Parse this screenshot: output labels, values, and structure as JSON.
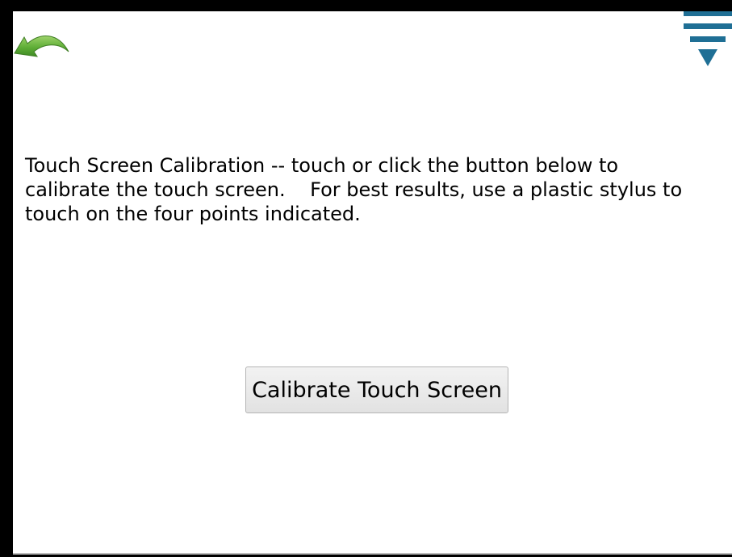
{
  "header": {
    "back_icon": "curved-back-arrow-icon",
    "menu_icon": "triangle-menu-icon"
  },
  "main": {
    "instructions": "Touch Screen Calibration -- touch or click the button below to\ncalibrate the touch screen.    For best results, use a plastic stylus to\ntouch on the four points indicated.",
    "calibrate_button_label": "Calibrate Touch Screen"
  },
  "colors": {
    "back_arrow": "#6cb33f",
    "menu_icon": "#1f6f95",
    "button_background": "#e9e9e9",
    "frame": "#000000"
  }
}
